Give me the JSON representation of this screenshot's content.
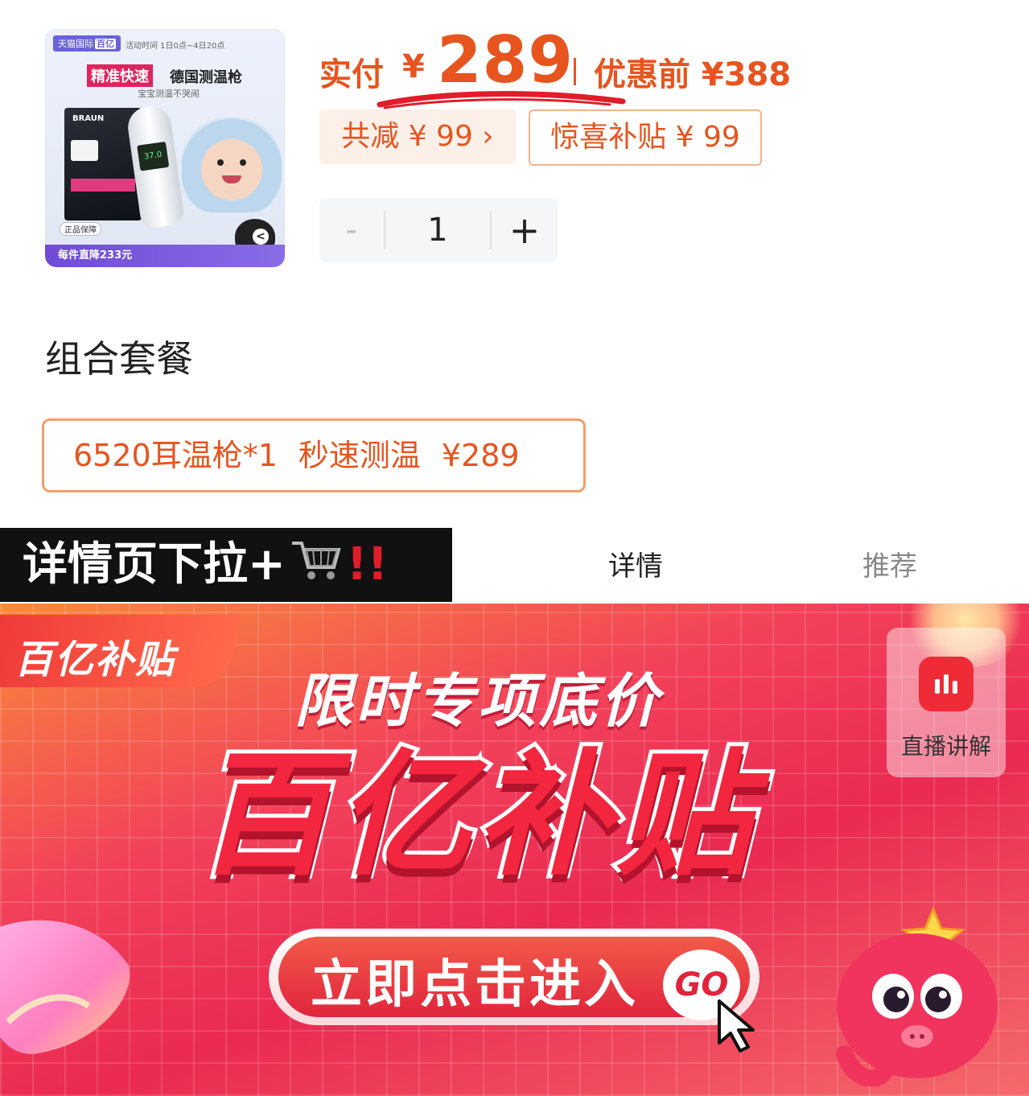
{
  "product": {
    "thumb": {
      "tmall_badge": "天猫国际",
      "tmall_badge_tag": "百亿",
      "activity_time": "活动时间 1日0点~4日20点",
      "highlight": "精准快速",
      "headline": "德国测温枪",
      "subline": "宝宝测温不哭闹",
      "brand": "BRAUN",
      "display_value": "37.0",
      "genuine": "正品保障",
      "drop_strip": "每件直降233元"
    },
    "price": {
      "pay_label": "实付",
      "currency": "¥",
      "pay_amount": "289",
      "pre_price": "优惠前 ¥388",
      "total_reduce": "共减 ¥ 99 ›",
      "surprise_subsidy": "惊喜补贴 ¥ 99"
    },
    "quantity": {
      "minus": "-",
      "value": "1",
      "plus": "+"
    }
  },
  "combo": {
    "title": "组合套餐",
    "option": {
      "name": "6520耳温枪*1",
      "feature": "秒速测温",
      "price": "¥289"
    }
  },
  "banner": {
    "text": "详情页下拉+",
    "exclaim": "!!"
  },
  "tabs": {
    "detail": "详情",
    "recommend": "推荐"
  },
  "promo": {
    "corner_label": "百亿补贴",
    "subtitle": "限时专项底价",
    "main": "百亿补贴",
    "cta": "立即点击进入",
    "go": "GO",
    "live_label": "直播讲解"
  },
  "colors": {
    "accent": "#e8541e",
    "promo_red": "#ea2a52",
    "banner_bg": "#111111",
    "thumb_strip": "#6f4bd8"
  },
  "icons": {
    "cart": "shopping-cart-icon",
    "cursor": "cursor-arrow-icon",
    "live": "live-bars-icon"
  }
}
